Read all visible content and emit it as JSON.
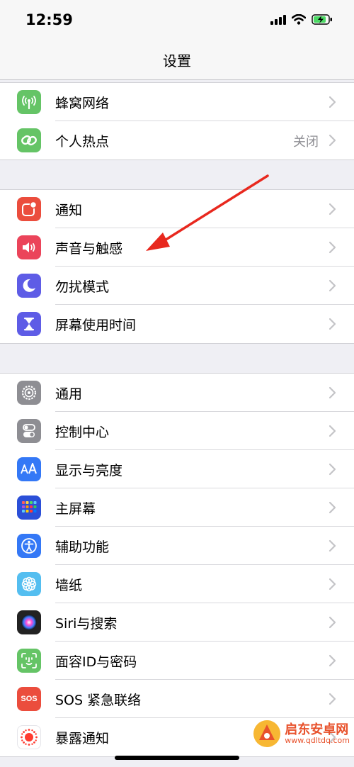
{
  "status_bar": {
    "time": "12:59"
  },
  "nav": {
    "title": "设置"
  },
  "groups": [
    {
      "items": [
        {
          "label": "蜂窝网络",
          "icon": "cellular-antenna-icon",
          "color": "#65c466"
        },
        {
          "label": "个人热点",
          "icon": "hotspot-chain-icon",
          "color": "#65c466",
          "value": "关闭"
        }
      ]
    },
    {
      "items": [
        {
          "label": "通知",
          "icon": "notifications-icon",
          "color": "#eb4d3d"
        },
        {
          "label": "声音与触感",
          "icon": "speaker-icon",
          "color": "#eb445a"
        },
        {
          "label": "勿扰模式",
          "icon": "moon-icon",
          "color": "#5e5ce6"
        },
        {
          "label": "屏幕使用时间",
          "icon": "hourglass-icon",
          "color": "#5e5ce6"
        }
      ]
    },
    {
      "items": [
        {
          "label": "通用",
          "icon": "gear-icon",
          "color": "#8e8e93"
        },
        {
          "label": "控制中心",
          "icon": "toggles-icon",
          "color": "#8e8e93"
        },
        {
          "label": "显示与亮度",
          "icon": "text-size-icon",
          "color": "#3478f6"
        },
        {
          "label": "主屏幕",
          "icon": "home-grid-icon",
          "color": "#3478f6"
        },
        {
          "label": "辅助功能",
          "icon": "accessibility-icon",
          "color": "#3478f6"
        },
        {
          "label": "墙纸",
          "icon": "flower-icon",
          "color": "#54bef0"
        },
        {
          "label": "Siri与搜索",
          "icon": "siri-icon",
          "color": "#222222"
        },
        {
          "label": "面容ID与密码",
          "icon": "face-id-icon",
          "color": "#65c466"
        },
        {
          "label": "SOS 紧急联络",
          "icon": "sos-icon",
          "color": "#eb4d3d",
          "icon_text": "SOS"
        },
        {
          "label": "暴露通知",
          "icon": "exposure-icon",
          "color": "#ffffff"
        }
      ]
    }
  ],
  "watermark": {
    "name": "启东安卓网",
    "url": "www.qdltdq.com"
  }
}
